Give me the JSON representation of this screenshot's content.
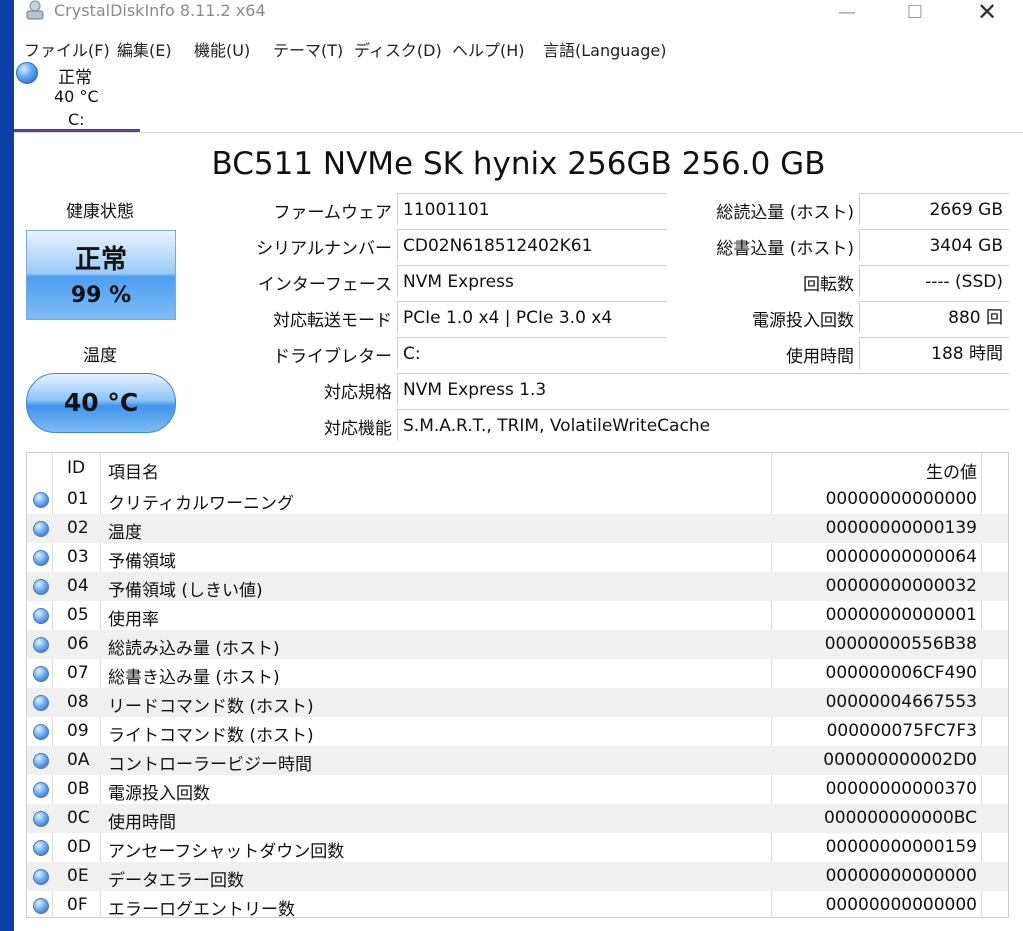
{
  "window": {
    "title": "CrystalDiskInfo 8.11.2 x64",
    "minimize_glyph": "—",
    "maximize_glyph": "☐",
    "close_glyph": "✕"
  },
  "menu": [
    "ファイル(F)",
    "編集(E)",
    "機能(U)",
    "テーマ(T)",
    "ディスク(D)",
    "ヘルプ(H)",
    "言語(Language)"
  ],
  "drive_tab": {
    "status": "正常",
    "temp": "40 °C",
    "letter": "C:"
  },
  "model": "BC511 NVMe SK hynix 256GB 256.0 GB",
  "health": {
    "label": "健康状態",
    "status": "正常",
    "percent": "99 %"
  },
  "temperature": {
    "label": "温度",
    "value": "40 °C"
  },
  "info_left": [
    {
      "label": "ファームウェア",
      "value": "11001101"
    },
    {
      "label": "シリアルナンバー",
      "value": "CD02N618512402K61"
    },
    {
      "label": "インターフェース",
      "value": "NVM Express"
    },
    {
      "label": "対応転送モード",
      "value": "PCIe 1.0 x4 | PCIe 3.0 x4"
    },
    {
      "label": "ドライブレター",
      "value": "C:"
    }
  ],
  "info_wide": [
    {
      "label": "対応規格",
      "value": "NVM Express 1.3"
    },
    {
      "label": "対応機能",
      "value": "S.M.A.R.T., TRIM, VolatileWriteCache"
    }
  ],
  "info_right": [
    {
      "label": "総読込量 (ホスト)",
      "value": "2669 GB"
    },
    {
      "label": "総書込量 (ホスト)",
      "value": "3404 GB"
    },
    {
      "label": "回転数",
      "value": "---- (SSD)"
    },
    {
      "label": "電源投入回数",
      "value": "880 回"
    },
    {
      "label": "使用時間",
      "value": "188 時間"
    }
  ],
  "smart": {
    "headers": {
      "id": "ID",
      "name": "項目名",
      "raw": "生の値"
    },
    "rows": [
      {
        "id": "01",
        "name": "クリティカルワーニング",
        "raw": "00000000000000"
      },
      {
        "id": "02",
        "name": "温度",
        "raw": "00000000000139"
      },
      {
        "id": "03",
        "name": "予備領域",
        "raw": "00000000000064"
      },
      {
        "id": "04",
        "name": "予備領域 (しきい値)",
        "raw": "00000000000032"
      },
      {
        "id": "05",
        "name": "使用率",
        "raw": "00000000000001"
      },
      {
        "id": "06",
        "name": "総読み込み量 (ホスト)",
        "raw": "00000000556B38"
      },
      {
        "id": "07",
        "name": "総書き込み量 (ホスト)",
        "raw": "000000006CF490"
      },
      {
        "id": "08",
        "name": "リードコマンド数 (ホスト)",
        "raw": "00000004667553"
      },
      {
        "id": "09",
        "name": "ライトコマンド数 (ホスト)",
        "raw": "000000075FC7F3"
      },
      {
        "id": "0A",
        "name": "コントローラービジー時間",
        "raw": "000000000002D0"
      },
      {
        "id": "0B",
        "name": "電源投入回数",
        "raw": "00000000000370"
      },
      {
        "id": "0C",
        "name": "使用時間",
        "raw": "000000000000BC"
      },
      {
        "id": "0D",
        "name": "アンセーフシャットダウン回数",
        "raw": "00000000000159"
      },
      {
        "id": "0E",
        "name": "データエラー回数",
        "raw": "00000000000000"
      },
      {
        "id": "0F",
        "name": "エラーログエントリー数",
        "raw": "00000000000000"
      }
    ]
  },
  "colors": {
    "accent": "#5a3fa0",
    "health_blue": "#4d9ef0",
    "desktop": "#0e3ea8"
  }
}
